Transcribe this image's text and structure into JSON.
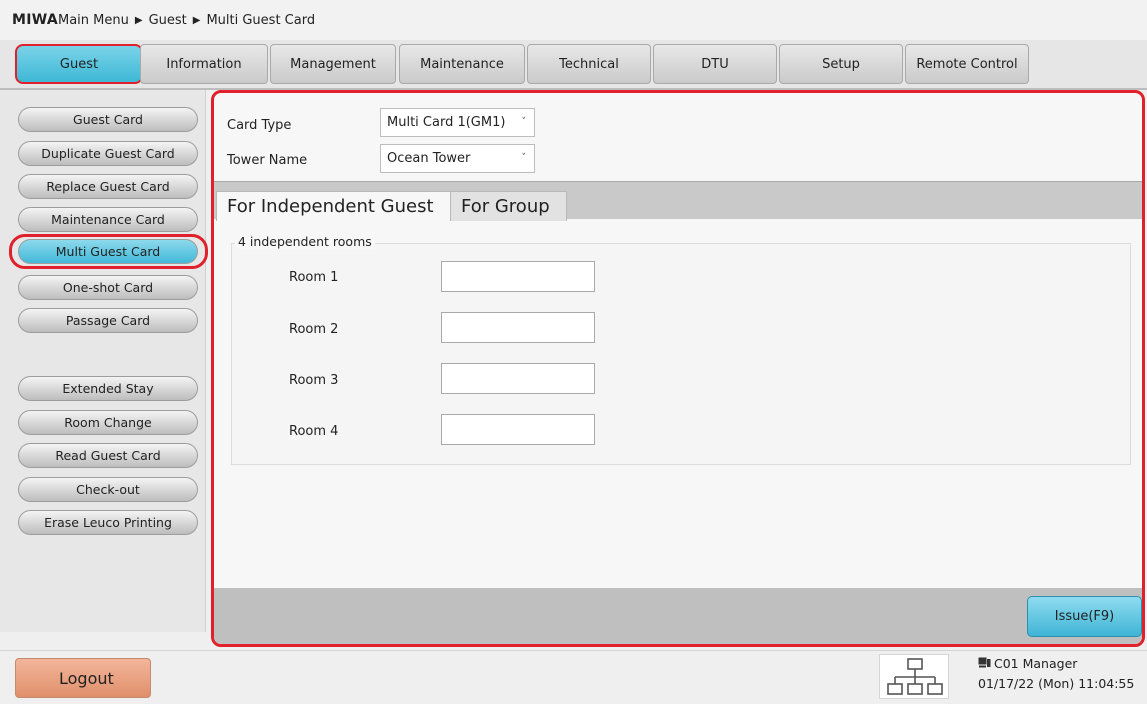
{
  "brand": "MIWA",
  "breadcrumb": [
    "Main Menu",
    "Guest",
    "Multi Guest Card"
  ],
  "menu_tabs": [
    {
      "label": "Guest",
      "active": true
    },
    {
      "label": "Information",
      "active": false
    },
    {
      "label": "Management",
      "active": false
    },
    {
      "label": "Maintenance",
      "active": false
    },
    {
      "label": "Technical",
      "active": false
    },
    {
      "label": "DTU",
      "active": false
    },
    {
      "label": "Setup",
      "active": false
    },
    {
      "label": "Remote Control",
      "active": false
    }
  ],
  "sidebar": {
    "items": [
      {
        "label": "Guest Card"
      },
      {
        "label": "Duplicate Guest Card"
      },
      {
        "label": "Replace Guest Card"
      },
      {
        "label": "Maintenance Card"
      },
      {
        "label": "Multi Guest Card",
        "active": true
      },
      {
        "label": "One-shot Card"
      },
      {
        "label": "Passage Card"
      },
      {
        "label": "Extended Stay"
      },
      {
        "label": "Room Change"
      },
      {
        "label": "Read Guest Card"
      },
      {
        "label": "Check-out"
      },
      {
        "label": "Erase Leuco Printing"
      }
    ]
  },
  "form": {
    "card_type_label": "Card Type",
    "card_type_value": "Multi Card 1(GM1)",
    "tower_name_label": "Tower Name",
    "tower_name_value": "Ocean Tower"
  },
  "subtabs": {
    "independent": "For Independent Guest",
    "group": "For Group"
  },
  "rooms": {
    "group_title": "4 independent rooms",
    "labels": [
      "Room 1",
      "Room 2",
      "Room 3",
      "Room 4"
    ],
    "values": [
      "",
      "",
      "",
      ""
    ]
  },
  "issue_button": "Issue(F9)",
  "logout_button": "Logout",
  "status": {
    "user": "C01 Manager",
    "datetime": "01/17/22 (Mon) 11:04:55"
  },
  "colors": {
    "accent_blue": "#41b9d8",
    "highlight_red": "#e0202a",
    "logout_orange": "#e08f6b"
  },
  "icons": {
    "breadcrumb_separator": "triangle-right-icon",
    "dropdown": "chevron-down-icon",
    "network": "network-icon",
    "terminal": "terminal-icon"
  }
}
